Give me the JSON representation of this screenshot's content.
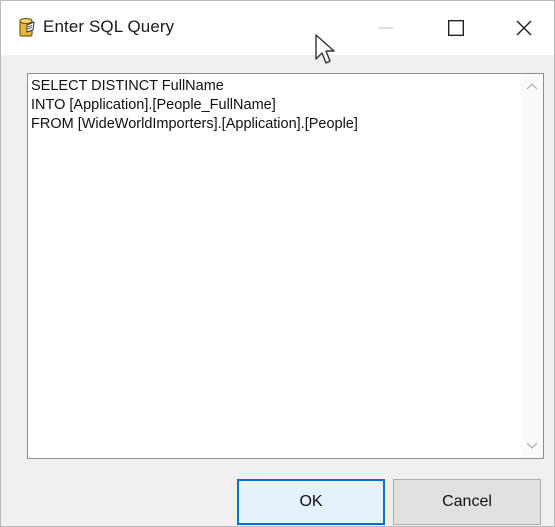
{
  "window": {
    "title": "Enter SQL Query"
  },
  "titlebar": {
    "icons": [
      "app-icon",
      "minimize-icon",
      "maximize-icon",
      "close-icon"
    ]
  },
  "query": {
    "lines": [
      "SELECT DISTINCT FullName",
      "INTO [Application].[People_FullName]",
      "FROM [WideWorldImporters].[Application].[People]"
    ]
  },
  "buttons": {
    "ok_label": "OK",
    "cancel_label": "Cancel"
  },
  "colors": {
    "focus_border": "#0b6fd6",
    "window_bg": "#f0f0f0"
  }
}
